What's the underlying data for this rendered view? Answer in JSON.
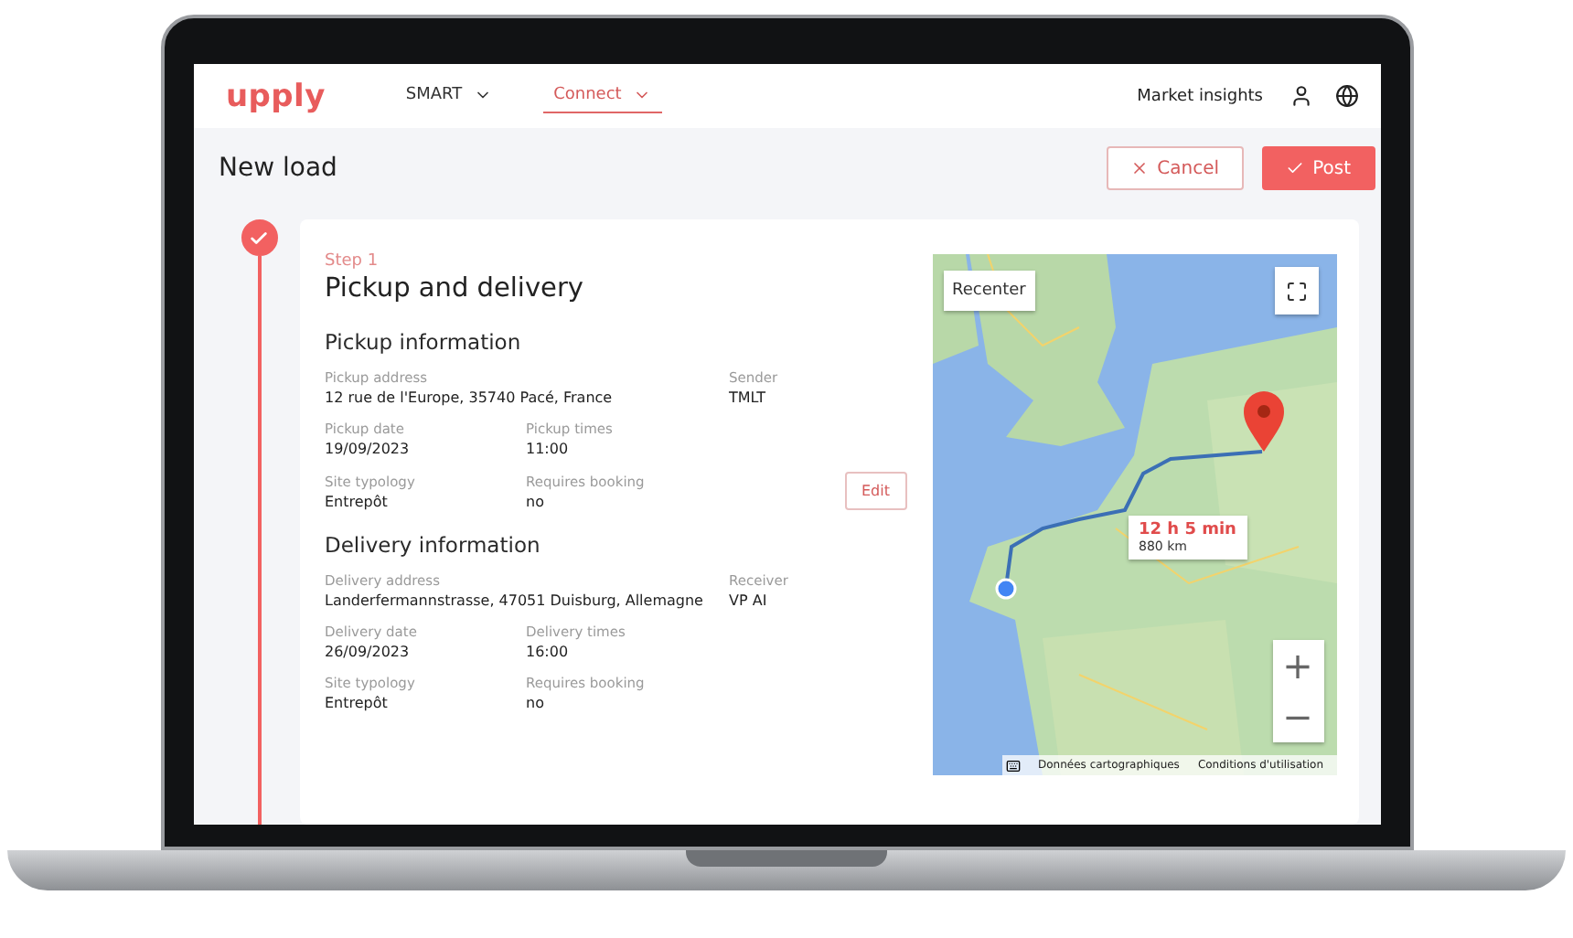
{
  "app": {
    "logo": "upply",
    "nav": [
      {
        "label": "SMART",
        "selected": false
      },
      {
        "label": "Connect",
        "selected": true
      }
    ],
    "links": [
      "Market insights"
    ]
  },
  "page": {
    "title": "New load",
    "buttons": [
      {
        "label": "Cancel",
        "kind": "secondary"
      },
      {
        "label": "Post",
        "kind": "primary"
      }
    ]
  },
  "step": {
    "number": "Step 1",
    "title": "Pickup and delivery",
    "completed": true,
    "sections": [
      {
        "title": "Pickup information",
        "address": {
          "label": "Pickup address",
          "value": "12 rue de l'Europe, 35740 Pacé, France"
        },
        "party": {
          "label": "Sender",
          "value": "TMLT"
        },
        "date": {
          "label": "Pickup date",
          "value": "19/09/2023"
        },
        "times": {
          "label": "Pickup times",
          "value": "11:00"
        },
        "typology": {
          "label": "Site typology",
          "value": "Entrepôt"
        },
        "booking": {
          "label": "Requires booking",
          "value": "no"
        },
        "edit_button": "Edit"
      },
      {
        "title": "Delivery information",
        "address": {
          "label": "Delivery address",
          "value": "Landerfermannstrasse, 47051 Duisburg, Allemagne"
        },
        "party": {
          "label": "Receiver",
          "value": "VP AI"
        },
        "date": {
          "label": "Delivery date",
          "value": "26/09/2023"
        },
        "times": {
          "label": "Delivery times",
          "value": "16:00"
        },
        "typology": {
          "label": "Site typology",
          "value": "Entrepôt"
        },
        "booking": {
          "label": "Requires booking",
          "value": "no"
        }
      }
    ]
  },
  "map": {
    "kind": "picture",
    "recenter": "Recenter",
    "route": {
      "duration": "12 h 5 min",
      "distance": "880 km"
    },
    "zoom_in": "+",
    "zoom_out": "−",
    "footer": [
      "Données cartographiques",
      "Conditions d'utilisation"
    ]
  }
}
